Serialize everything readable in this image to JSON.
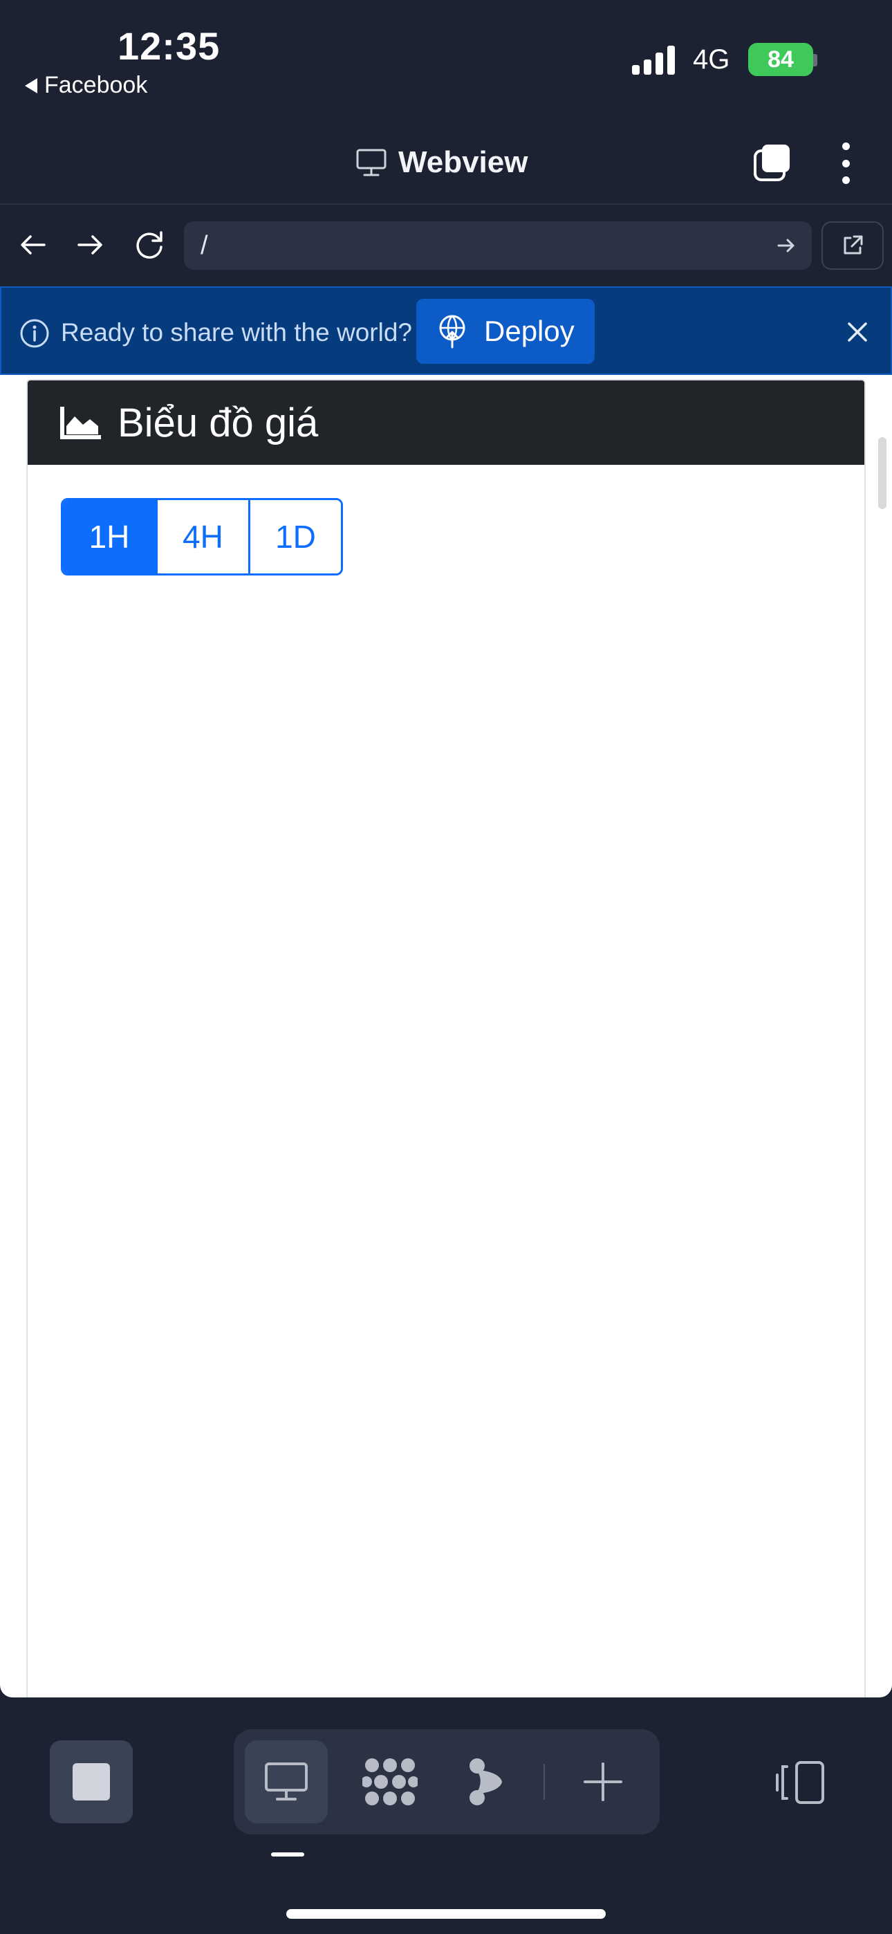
{
  "status_bar": {
    "time": "12:35",
    "back_app": "Facebook",
    "network": "4G",
    "battery": "84"
  },
  "header": {
    "title": "Webview"
  },
  "urlbar": {
    "url": "/"
  },
  "banner": {
    "message": "Ready to share with the world?",
    "deploy_label": "Deploy"
  },
  "page": {
    "card_title": "Biểu đồ giá",
    "timeframes": [
      "1H",
      "4H",
      "1D"
    ],
    "active_timeframe": "1H"
  },
  "colors": {
    "app_bg": "#1c2232",
    "banner_bg": "#063b7e",
    "primary": "#0d6efd",
    "card_header": "#212529",
    "battery": "#3fc95a"
  },
  "icons": {
    "header": "monitor-icon",
    "tabs": "tabs-icon",
    "more": "more-vertical-icon",
    "back": "arrow-left-icon",
    "forward": "arrow-right-icon",
    "reload": "reload-icon",
    "go": "arrow-right-icon",
    "open_external": "external-link-icon",
    "info": "info-icon",
    "deploy": "deploy-icon",
    "close": "close-icon",
    "chart": "area-chart-icon",
    "stop": "stop-icon",
    "webview_tool": "monitor-icon",
    "extensions_tool": "extensions-icon",
    "agent_tool": "agent-icon",
    "add_tool": "plus-icon",
    "split": "split-view-icon"
  }
}
